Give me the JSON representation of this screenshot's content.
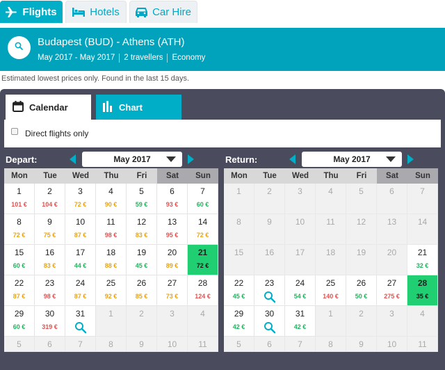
{
  "tabs": [
    {
      "label": "Flights",
      "icon": "plane-icon",
      "active": true
    },
    {
      "label": "Hotels",
      "icon": "bed-icon",
      "active": false
    },
    {
      "label": "Car Hire",
      "icon": "car-icon",
      "active": false
    }
  ],
  "route": {
    "title": "Budapest (BUD) - Athens (ATH)",
    "dates": "May 2017 - May 2017",
    "travellers": "2 travellers",
    "cabin": "Economy"
  },
  "note": "Estimated lowest prices only. Found in the last 15 days.",
  "view_tabs": {
    "calendar": "Calendar",
    "chart": "Chart"
  },
  "direct_only": "Direct flights only",
  "colors": {
    "accent": "#00aec7",
    "green": "#21b35d",
    "amber": "#e8a317",
    "red": "#e3514f",
    "selected": "#20cf72"
  },
  "weekdays": [
    "Mon",
    "Tue",
    "Wed",
    "Thu",
    "Fri",
    "Sat",
    "Sun"
  ],
  "depart": {
    "label": "Depart:",
    "month": "May 2017",
    "weeks": [
      [
        {
          "d": "1",
          "p": "101 €",
          "c": "r"
        },
        {
          "d": "2",
          "p": "104 €",
          "c": "r"
        },
        {
          "d": "3",
          "p": "72 €",
          "c": "y"
        },
        {
          "d": "4",
          "p": "90 €",
          "c": "y"
        },
        {
          "d": "5",
          "p": "59 €",
          "c": "g"
        },
        {
          "d": "6",
          "p": "93 €",
          "c": "r"
        },
        {
          "d": "7",
          "p": "60 €",
          "c": "g"
        }
      ],
      [
        {
          "d": "8",
          "p": "72 €",
          "c": "y"
        },
        {
          "d": "9",
          "p": "75 €",
          "c": "y"
        },
        {
          "d": "10",
          "p": "87 €",
          "c": "y"
        },
        {
          "d": "11",
          "p": "98 €",
          "c": "r"
        },
        {
          "d": "12",
          "p": "83 €",
          "c": "y"
        },
        {
          "d": "13",
          "p": "95 €",
          "c": "r"
        },
        {
          "d": "14",
          "p": "72 €",
          "c": "y"
        }
      ],
      [
        {
          "d": "15",
          "p": "60 €",
          "c": "g"
        },
        {
          "d": "16",
          "p": "83 €",
          "c": "y"
        },
        {
          "d": "17",
          "p": "44 €",
          "c": "g"
        },
        {
          "d": "18",
          "p": "88 €",
          "c": "y"
        },
        {
          "d": "19",
          "p": "45 €",
          "c": "g"
        },
        {
          "d": "20",
          "p": "89 €",
          "c": "y"
        },
        {
          "d": "21",
          "p": "72 €",
          "c": "k",
          "sel": true
        }
      ],
      [
        {
          "d": "22",
          "p": "87 €",
          "c": "y"
        },
        {
          "d": "23",
          "p": "98 €",
          "c": "r"
        },
        {
          "d": "24",
          "p": "87 €",
          "c": "y"
        },
        {
          "d": "25",
          "p": "92 €",
          "c": "y"
        },
        {
          "d": "26",
          "p": "85 €",
          "c": "y"
        },
        {
          "d": "27",
          "p": "73 €",
          "c": "y"
        },
        {
          "d": "28",
          "p": "124 €",
          "c": "r"
        }
      ],
      [
        {
          "d": "29",
          "p": "60 €",
          "c": "g"
        },
        {
          "d": "30",
          "p": "319 €",
          "c": "r"
        },
        {
          "d": "31",
          "search": true
        },
        {
          "d": "1",
          "off": true
        },
        {
          "d": "2",
          "off": true
        },
        {
          "d": "3",
          "off": true
        },
        {
          "d": "4",
          "off": true
        }
      ],
      [
        {
          "d": "5",
          "off": true
        },
        {
          "d": "6",
          "off": true
        },
        {
          "d": "7",
          "off": true
        },
        {
          "d": "8",
          "off": true
        },
        {
          "d": "9",
          "off": true
        },
        {
          "d": "10",
          "off": true
        },
        {
          "d": "11",
          "off": true
        }
      ]
    ]
  },
  "return": {
    "label": "Return:",
    "month": "May 2017",
    "weeks": [
      [
        {
          "d": "1",
          "off": true
        },
        {
          "d": "2",
          "off": true
        },
        {
          "d": "3",
          "off": true
        },
        {
          "d": "4",
          "off": true
        },
        {
          "d": "5",
          "off": true
        },
        {
          "d": "6",
          "off": true
        },
        {
          "d": "7",
          "off": true
        }
      ],
      [
        {
          "d": "8",
          "off": true
        },
        {
          "d": "9",
          "off": true
        },
        {
          "d": "10",
          "off": true
        },
        {
          "d": "11",
          "off": true
        },
        {
          "d": "12",
          "off": true
        },
        {
          "d": "13",
          "off": true
        },
        {
          "d": "14",
          "off": true
        }
      ],
      [
        {
          "d": "15",
          "off": true
        },
        {
          "d": "16",
          "off": true
        },
        {
          "d": "17",
          "off": true
        },
        {
          "d": "18",
          "off": true
        },
        {
          "d": "19",
          "off": true
        },
        {
          "d": "20",
          "off": true
        },
        {
          "d": "21",
          "p": "32 €",
          "c": "g"
        }
      ],
      [
        {
          "d": "22",
          "p": "45 €",
          "c": "g"
        },
        {
          "d": "23",
          "search": true
        },
        {
          "d": "24",
          "p": "54 €",
          "c": "g"
        },
        {
          "d": "25",
          "p": "140 €",
          "c": "r"
        },
        {
          "d": "26",
          "p": "50 €",
          "c": "g"
        },
        {
          "d": "27",
          "p": "275 €",
          "c": "r"
        },
        {
          "d": "28",
          "p": "35 €",
          "c": "k",
          "sel": true
        }
      ],
      [
        {
          "d": "29",
          "p": "42 €",
          "c": "g"
        },
        {
          "d": "30",
          "search": true
        },
        {
          "d": "31",
          "p": "42 €",
          "c": "g"
        },
        {
          "d": "1",
          "off": true
        },
        {
          "d": "2",
          "off": true
        },
        {
          "d": "3",
          "off": true
        },
        {
          "d": "4",
          "off": true
        }
      ],
      [
        {
          "d": "5",
          "off": true
        },
        {
          "d": "6",
          "off": true
        },
        {
          "d": "7",
          "off": true
        },
        {
          "d": "8",
          "off": true
        },
        {
          "d": "9",
          "off": true
        },
        {
          "d": "10",
          "off": true
        },
        {
          "d": "11",
          "off": true
        }
      ]
    ]
  }
}
